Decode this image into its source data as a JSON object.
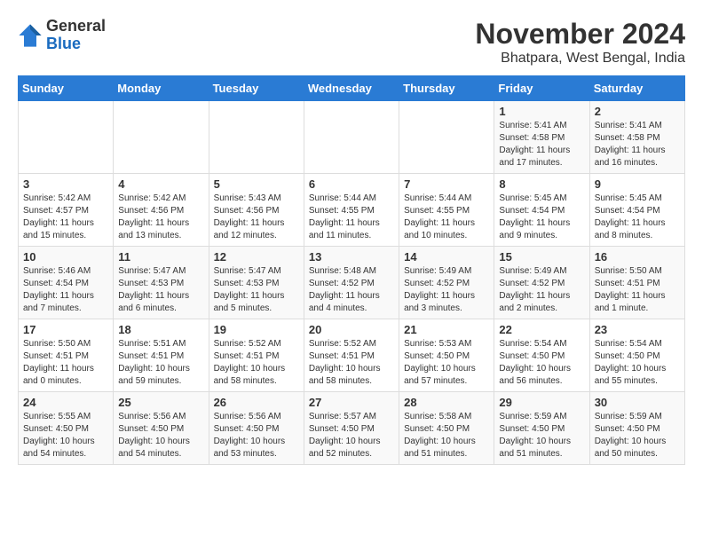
{
  "header": {
    "logo_general": "General",
    "logo_blue": "Blue",
    "month_title": "November 2024",
    "location": "Bhatpara, West Bengal, India"
  },
  "calendar": {
    "days_of_week": [
      "Sunday",
      "Monday",
      "Tuesday",
      "Wednesday",
      "Thursday",
      "Friday",
      "Saturday"
    ],
    "weeks": [
      [
        {
          "day": "",
          "info": ""
        },
        {
          "day": "",
          "info": ""
        },
        {
          "day": "",
          "info": ""
        },
        {
          "day": "",
          "info": ""
        },
        {
          "day": "",
          "info": ""
        },
        {
          "day": "1",
          "info": "Sunrise: 5:41 AM\nSunset: 4:58 PM\nDaylight: 11 hours and 17 minutes."
        },
        {
          "day": "2",
          "info": "Sunrise: 5:41 AM\nSunset: 4:58 PM\nDaylight: 11 hours and 16 minutes."
        }
      ],
      [
        {
          "day": "3",
          "info": "Sunrise: 5:42 AM\nSunset: 4:57 PM\nDaylight: 11 hours and 15 minutes."
        },
        {
          "day": "4",
          "info": "Sunrise: 5:42 AM\nSunset: 4:56 PM\nDaylight: 11 hours and 13 minutes."
        },
        {
          "day": "5",
          "info": "Sunrise: 5:43 AM\nSunset: 4:56 PM\nDaylight: 11 hours and 12 minutes."
        },
        {
          "day": "6",
          "info": "Sunrise: 5:44 AM\nSunset: 4:55 PM\nDaylight: 11 hours and 11 minutes."
        },
        {
          "day": "7",
          "info": "Sunrise: 5:44 AM\nSunset: 4:55 PM\nDaylight: 11 hours and 10 minutes."
        },
        {
          "day": "8",
          "info": "Sunrise: 5:45 AM\nSunset: 4:54 PM\nDaylight: 11 hours and 9 minutes."
        },
        {
          "day": "9",
          "info": "Sunrise: 5:45 AM\nSunset: 4:54 PM\nDaylight: 11 hours and 8 minutes."
        }
      ],
      [
        {
          "day": "10",
          "info": "Sunrise: 5:46 AM\nSunset: 4:54 PM\nDaylight: 11 hours and 7 minutes."
        },
        {
          "day": "11",
          "info": "Sunrise: 5:47 AM\nSunset: 4:53 PM\nDaylight: 11 hours and 6 minutes."
        },
        {
          "day": "12",
          "info": "Sunrise: 5:47 AM\nSunset: 4:53 PM\nDaylight: 11 hours and 5 minutes."
        },
        {
          "day": "13",
          "info": "Sunrise: 5:48 AM\nSunset: 4:52 PM\nDaylight: 11 hours and 4 minutes."
        },
        {
          "day": "14",
          "info": "Sunrise: 5:49 AM\nSunset: 4:52 PM\nDaylight: 11 hours and 3 minutes."
        },
        {
          "day": "15",
          "info": "Sunrise: 5:49 AM\nSunset: 4:52 PM\nDaylight: 11 hours and 2 minutes."
        },
        {
          "day": "16",
          "info": "Sunrise: 5:50 AM\nSunset: 4:51 PM\nDaylight: 11 hours and 1 minute."
        }
      ],
      [
        {
          "day": "17",
          "info": "Sunrise: 5:50 AM\nSunset: 4:51 PM\nDaylight: 11 hours and 0 minutes."
        },
        {
          "day": "18",
          "info": "Sunrise: 5:51 AM\nSunset: 4:51 PM\nDaylight: 10 hours and 59 minutes."
        },
        {
          "day": "19",
          "info": "Sunrise: 5:52 AM\nSunset: 4:51 PM\nDaylight: 10 hours and 58 minutes."
        },
        {
          "day": "20",
          "info": "Sunrise: 5:52 AM\nSunset: 4:51 PM\nDaylight: 10 hours and 58 minutes."
        },
        {
          "day": "21",
          "info": "Sunrise: 5:53 AM\nSunset: 4:50 PM\nDaylight: 10 hours and 57 minutes."
        },
        {
          "day": "22",
          "info": "Sunrise: 5:54 AM\nSunset: 4:50 PM\nDaylight: 10 hours and 56 minutes."
        },
        {
          "day": "23",
          "info": "Sunrise: 5:54 AM\nSunset: 4:50 PM\nDaylight: 10 hours and 55 minutes."
        }
      ],
      [
        {
          "day": "24",
          "info": "Sunrise: 5:55 AM\nSunset: 4:50 PM\nDaylight: 10 hours and 54 minutes."
        },
        {
          "day": "25",
          "info": "Sunrise: 5:56 AM\nSunset: 4:50 PM\nDaylight: 10 hours and 54 minutes."
        },
        {
          "day": "26",
          "info": "Sunrise: 5:56 AM\nSunset: 4:50 PM\nDaylight: 10 hours and 53 minutes."
        },
        {
          "day": "27",
          "info": "Sunrise: 5:57 AM\nSunset: 4:50 PM\nDaylight: 10 hours and 52 minutes."
        },
        {
          "day": "28",
          "info": "Sunrise: 5:58 AM\nSunset: 4:50 PM\nDaylight: 10 hours and 51 minutes."
        },
        {
          "day": "29",
          "info": "Sunrise: 5:59 AM\nSunset: 4:50 PM\nDaylight: 10 hours and 51 minutes."
        },
        {
          "day": "30",
          "info": "Sunrise: 5:59 AM\nSunset: 4:50 PM\nDaylight: 10 hours and 50 minutes."
        }
      ]
    ]
  }
}
